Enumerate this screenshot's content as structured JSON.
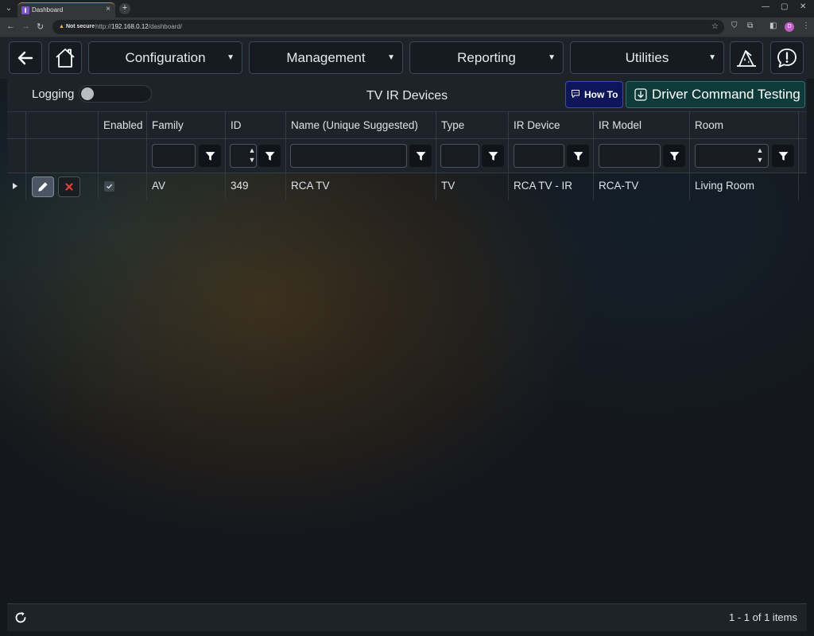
{
  "browser": {
    "tab_title": "Dashboard",
    "not_secure": "Not secure",
    "url_prefix": "http://",
    "url_host": "192.168.0.12",
    "url_path": "/dashboard/",
    "profile_initial": "D"
  },
  "nav": {
    "menus": [
      {
        "label": "Configuration"
      },
      {
        "label": "Management"
      },
      {
        "label": "Reporting"
      },
      {
        "label": "Utilities"
      }
    ]
  },
  "panel": {
    "logging_label": "Logging",
    "logging_enabled": false,
    "title": "TV IR Devices",
    "howto_label": "How To",
    "driver_test_label": "Driver Command Testing"
  },
  "grid": {
    "columns": [
      "Enabled",
      "Family",
      "ID",
      "Name (Unique Suggested)",
      "Type",
      "IR Device",
      "IR Model",
      "Room"
    ],
    "rows": [
      {
        "enabled": true,
        "family": "AV",
        "id": "349",
        "name": "RCA TV",
        "type": "TV",
        "ir_device": "RCA TV - IR",
        "ir_model": "RCA-TV",
        "room": "Living Room"
      }
    ]
  },
  "footer": {
    "page_info": "1 - 1 of 1 items"
  },
  "colors": {
    "howto_bg": "#0f1559",
    "driver_test_bg": "#0e3a3a",
    "delete_x": "#e0443c",
    "tab_accent": "#b58a58"
  }
}
